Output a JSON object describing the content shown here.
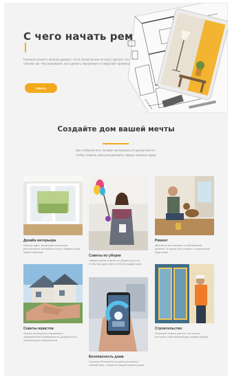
{
  "hero": {
    "title": "С чего начать ремонт",
    "description": "Начиная ремонт, многие думают, что в своей жизни не могут делать что хотят. Это не совсем так. Рассказываем, как сделать евроремонт в квартире правильно в 2020 году",
    "button_label": "Узнать"
  },
  "section": {
    "title": "Создайте дом вашей мечты",
    "description": "Мы собрали все лучшие материалы в одном месте, чтобы помочь вам реализовать самые смелые идеи"
  },
  "cards": [
    {
      "title": "Дизайн интерьера",
      "text": "Лучшие идеи, тенденции и решения, рассчитанных на любые стили и бюджеты для вашей квартиры"
    },
    {
      "title": "Советы по уборке",
      "text": "Самые разные советы по уборке для того, чтобы ваш дом сиял чистотой каждый день"
    },
    {
      "title": "Ремонт",
      "text": "Многие из нас мечтают о собственном ремонте, и лучше всего начать с тщательной подготовки"
    },
    {
      "title": "Советы юристов",
      "text": "Ответы на вопросы, связанные с оформлением недвижимости, документов и консультации специалистов"
    },
    {
      "title": "Безопасность дома",
      "text": "Хорошая безопасность дома для вашего спокойствия. Советы по защите вашего дома"
    },
    {
      "title": "Строительство",
      "text": "Полезные советы для тех, кто решил построить собственный дом своими руками"
    }
  ],
  "colors": {
    "accent": "#f2a91c",
    "background": "#f3f3f3",
    "heading": "#3a3a3a",
    "body_text": "#8a8a8a"
  }
}
